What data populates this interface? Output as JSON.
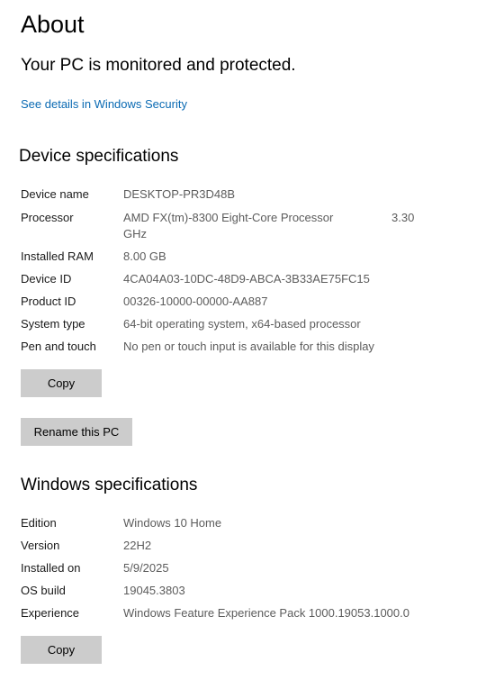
{
  "page": {
    "title": "About",
    "protection_status": "Your PC is monitored and protected.",
    "security_link": "See details in Windows Security"
  },
  "device_specs": {
    "title": "Device specifications",
    "device_name_label": "Device name",
    "device_name_value": "DESKTOP-PR3D48B",
    "processor_label": "Processor",
    "processor_value_line1": "AMD FX(tm)-8300 Eight-Core Processor",
    "processor_speed": "3.30",
    "processor_value_line2": "GHz",
    "ram_label": "Installed RAM",
    "ram_value": "8.00 GB",
    "device_id_label": "Device ID",
    "device_id_value": "4CA04A03-10DC-48D9-ABCA-3B33AE75FC15",
    "product_id_label": "Product ID",
    "product_id_value": "00326-10000-00000-AA887",
    "system_type_label": "System type",
    "system_type_value": "64-bit operating system, x64-based processor",
    "pen_touch_label": "Pen and touch",
    "pen_touch_value": "No pen or touch input is available for this display",
    "copy_button": "Copy",
    "rename_button": "Rename this PC"
  },
  "windows_specs": {
    "title": "Windows specifications",
    "edition_label": "Edition",
    "edition_value": "Windows 10 Home",
    "version_label": "Version",
    "version_value": "22H2",
    "installed_on_label": "Installed on",
    "installed_on_value": "5/9/2025",
    "os_build_label": "OS build",
    "os_build_value": "19045.3803",
    "experience_label": "Experience",
    "experience_value": "Windows Feature Experience Pack 1000.19053.1000.0",
    "copy_button": "Copy"
  }
}
